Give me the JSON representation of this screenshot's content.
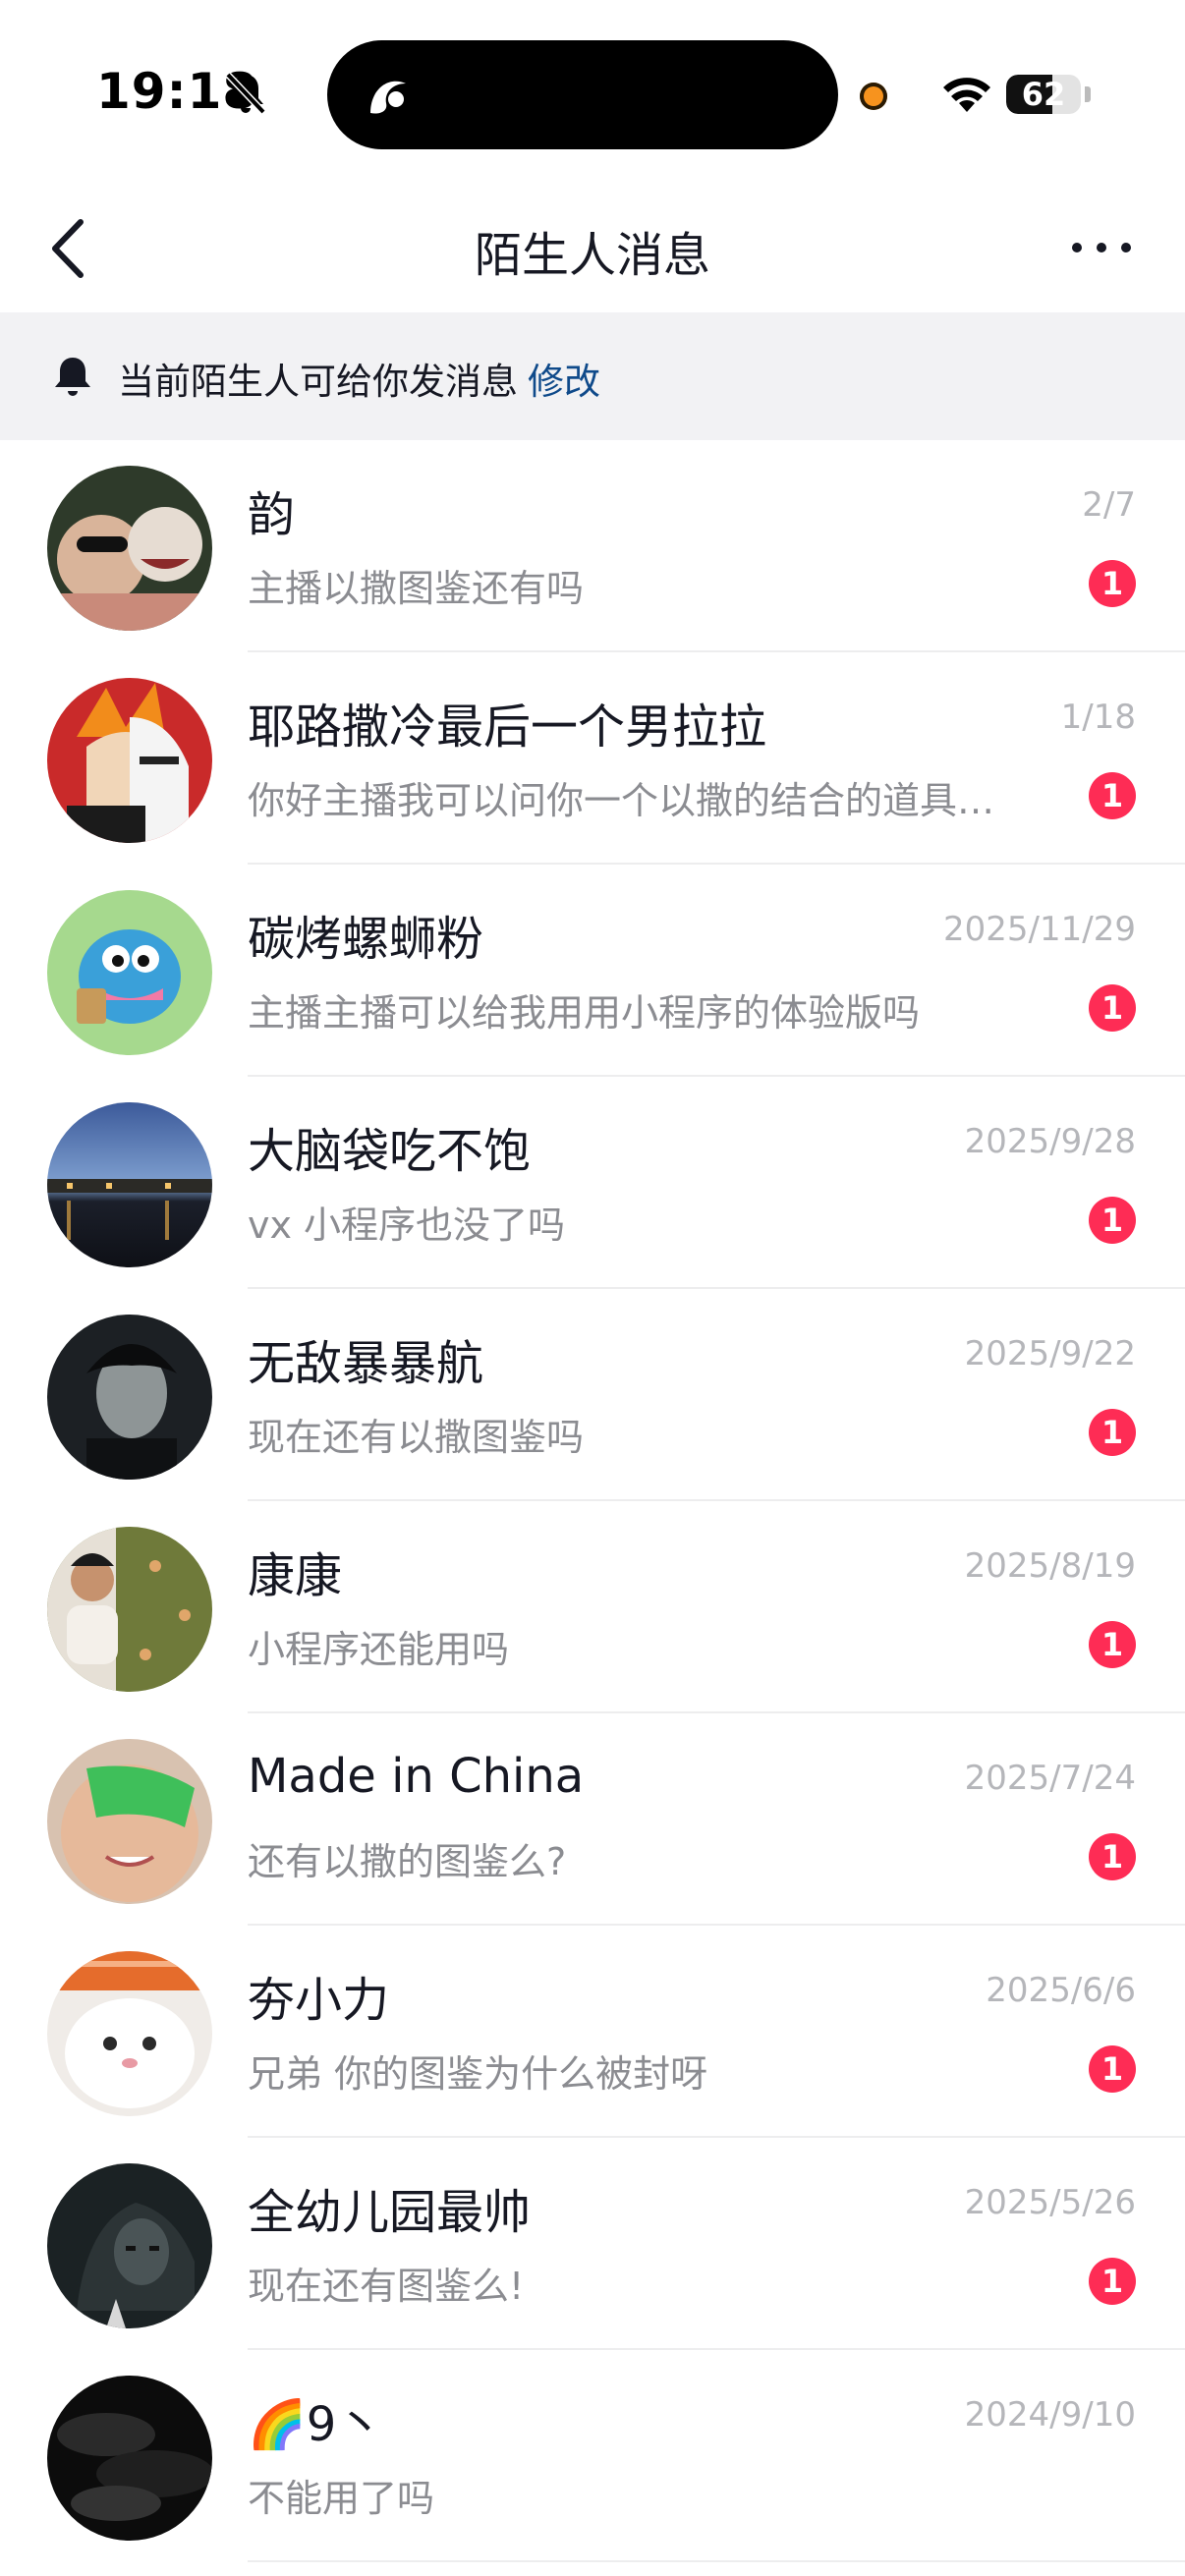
{
  "status_bar": {
    "time": "19:18",
    "battery_text": "62",
    "battery_level": 0.62
  },
  "nav": {
    "title": "陌生人消息"
  },
  "notice": {
    "text": "当前陌生人可给你发消息",
    "link": "修改"
  },
  "conversations": [
    {
      "name": "韵",
      "date": "2/7",
      "preview": "主播以撒图鉴还有吗",
      "unread": "1",
      "avatar": "couple-photo"
    },
    {
      "name": "耶路撒冷最后一个男拉拉",
      "date": "1/18",
      "preview": "你好主播我可以问你一个以撒的结合的道具…",
      "unread": "1",
      "avatar": "anime-hollow-mask"
    },
    {
      "name": "碳烤螺蛳粉",
      "date": "2025/11/29",
      "preview": "主播主播可以给我用用小程序的体验版吗",
      "unread": "1",
      "avatar": "blue-cartoon-fish"
    },
    {
      "name": "大脑袋吃不饱",
      "date": "2025/9/28",
      "preview": "vx 小程序也没了吗",
      "unread": "1",
      "avatar": "night-water-town"
    },
    {
      "name": "无敌暴暴航",
      "date": "2025/9/22",
      "preview": "现在还有以撒图鉴吗",
      "unread": "1",
      "avatar": "dark-portrait"
    },
    {
      "name": "康康",
      "date": "2025/8/19",
      "preview": "小程序还能用吗",
      "unread": "1",
      "avatar": "person-with-wallpaper"
    },
    {
      "name": "Made in China",
      "date": "2025/7/24",
      "preview": "还有以撒的图鉴么?",
      "unread": "1",
      "avatar": "green-sunglasses-face"
    },
    {
      "name": "夯小力",
      "date": "2025/6/6",
      "preview": "兄弟 你的图鉴为什么被封呀",
      "unread": "1",
      "avatar": "cat-with-sushi"
    },
    {
      "name": "全幼儿园最帅",
      "date": "2025/5/26",
      "preview": "现在还有图鉴么!",
      "unread": "1",
      "avatar": "dark-anime-character"
    },
    {
      "name": "🌈9丶",
      "date": "2024/9/10",
      "preview": "不能用了吗",
      "unread": "",
      "avatar": "dark-clouds"
    }
  ],
  "colors": {
    "badge": "#fe2c55",
    "link": "#0f4a8a",
    "notice_bg": "#f2f2f4"
  }
}
